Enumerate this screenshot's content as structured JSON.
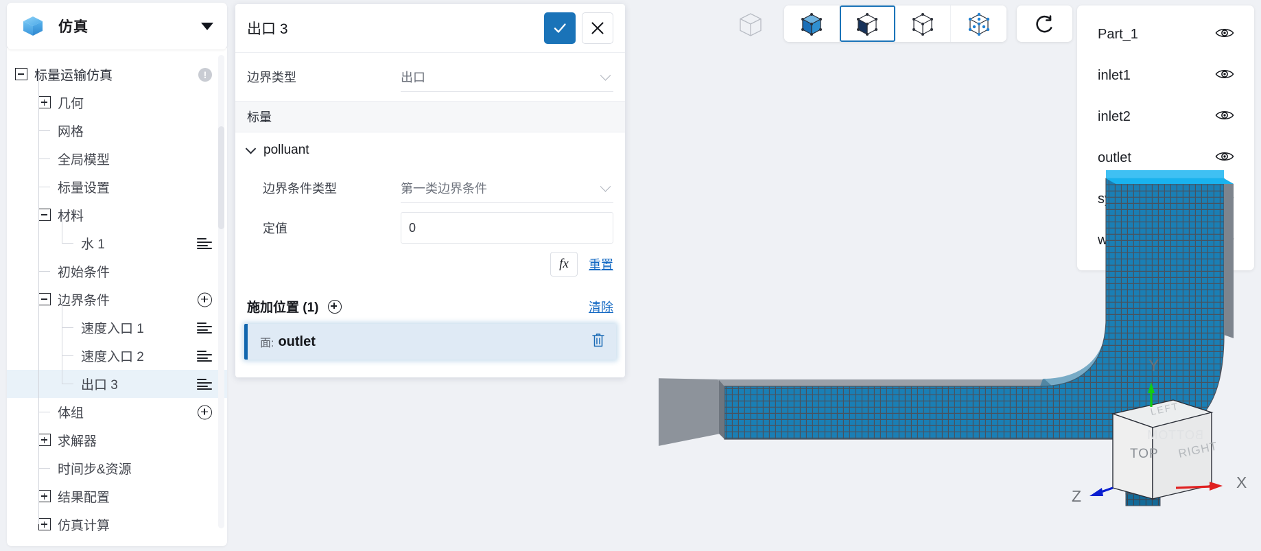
{
  "app": {
    "logo_icon": "cube-icon",
    "title": "仿真",
    "dropdown_icon": "caret-down-icon"
  },
  "sidebar": {
    "tree": [
      {
        "label": "标量运输仿真",
        "expander": "minus",
        "depth": 0,
        "right_icon": "warning-badge",
        "selected": false
      },
      {
        "label": "几何",
        "expander": "plus",
        "depth": 1,
        "right_icon": "",
        "selected": false
      },
      {
        "label": "网格",
        "expander": "",
        "depth": 1,
        "right_icon": "",
        "selected": false
      },
      {
        "label": "全局模型",
        "expander": "",
        "depth": 1,
        "right_icon": "",
        "selected": false
      },
      {
        "label": "标量设置",
        "expander": "",
        "depth": 1,
        "right_icon": "",
        "selected": false
      },
      {
        "label": "材料",
        "expander": "minus",
        "depth": 1,
        "right_icon": "",
        "selected": false
      },
      {
        "label": "水 1",
        "expander": "",
        "depth": 2,
        "right_icon": "menu-icon",
        "selected": false
      },
      {
        "label": "初始条件",
        "expander": "",
        "depth": 1,
        "right_icon": "",
        "selected": false
      },
      {
        "label": "边界条件",
        "expander": "minus",
        "depth": 1,
        "right_icon": "plus-icon",
        "selected": false
      },
      {
        "label": "速度入口 1",
        "expander": "",
        "depth": 2,
        "right_icon": "menu-icon",
        "selected": false
      },
      {
        "label": "速度入口 2",
        "expander": "",
        "depth": 2,
        "right_icon": "menu-icon",
        "selected": false
      },
      {
        "label": "出口 3",
        "expander": "",
        "depth": 2,
        "right_icon": "menu-icon",
        "selected": true
      },
      {
        "label": "体组",
        "expander": "",
        "depth": 1,
        "right_icon": "plus-icon",
        "selected": false
      },
      {
        "label": "求解器",
        "expander": "plus",
        "depth": 1,
        "right_icon": "",
        "selected": false
      },
      {
        "label": "时间步&资源",
        "expander": "",
        "depth": 1,
        "right_icon": "",
        "selected": false
      },
      {
        "label": "结果配置",
        "expander": "plus",
        "depth": 1,
        "right_icon": "",
        "selected": false
      },
      {
        "label": "仿真计算",
        "expander": "plus",
        "depth": 1,
        "right_icon": "",
        "selected": false
      }
    ]
  },
  "dialog": {
    "title": "出口 3",
    "confirm_icon": "check-icon",
    "cancel_icon": "close-icon",
    "boundary_type_label": "边界类型",
    "boundary_type_value": "出口",
    "section_scalar": "标量",
    "group_name": "polluant",
    "bc_type_label": "边界条件类型",
    "bc_type_value": "第一类边界条件",
    "const_label": "定值",
    "const_value": "0",
    "fx_label": "fx",
    "reset_label": "重置",
    "location_title": "施加位置 (1)",
    "location_add_icon": "plus-circle-icon",
    "clear_label": "清除",
    "location_items": [
      {
        "kind": "面:",
        "name": "outlet",
        "delete_icon": "trash-icon"
      }
    ]
  },
  "toolbar": {
    "ghost_cube_icon": "wireframe-cube-icon",
    "buttons": [
      {
        "icon": "shaded-cube-icon",
        "active": false
      },
      {
        "icon": "shaded-edges-cube-icon",
        "active": true
      },
      {
        "icon": "wireframe-cube-icon",
        "active": false
      },
      {
        "icon": "points-cube-icon",
        "active": false
      }
    ],
    "refresh_icon": "reset-view-icon"
  },
  "parts_panel": {
    "items": [
      {
        "name": "Part_1",
        "visibility_icon": "eye-icon"
      },
      {
        "name": "inlet1",
        "visibility_icon": "eye-icon"
      },
      {
        "name": "inlet2",
        "visibility_icon": "eye-icon"
      },
      {
        "name": "outlet",
        "visibility_icon": "eye-icon"
      },
      {
        "name": "symm",
        "visibility_icon": "eye-icon"
      },
      {
        "name": "wall",
        "visibility_icon": "eye-icon"
      }
    ]
  },
  "axis_widget": {
    "labels": {
      "x": "X",
      "y": "Y",
      "z": "Z"
    },
    "cube_faces": {
      "front": "TOP",
      "right": "RIGHT",
      "top": "LEFT",
      "hidden": "BOTTOM"
    },
    "axis_colors": {
      "x": "#e02020",
      "y": "#12cc12",
      "z": "#0b1fd0"
    }
  },
  "colors": {
    "accent": "#1a73b8",
    "selection_bg": "#e9f2f9",
    "panel_bg": "#ffffff",
    "canvas_bg": "#eff1f5",
    "mesh_fill": "#1a7fb5",
    "mesh_edge": "#3f4752",
    "highlight_edge": "#19b3ef"
  }
}
